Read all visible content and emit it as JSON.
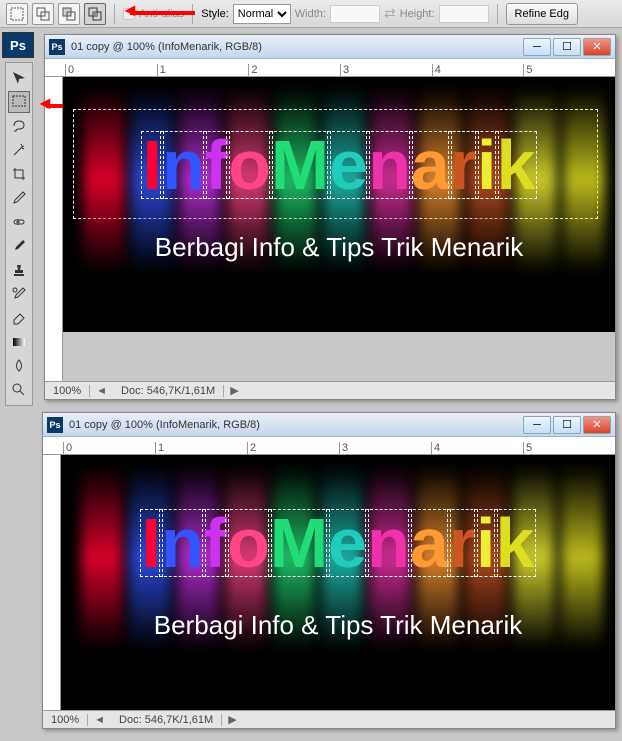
{
  "optionsBar": {
    "antialias": "Anti-alias",
    "styleLabel": "Style:",
    "styleValue": "Normal",
    "widthLabel": "Width:",
    "heightLabel": "Height:",
    "refineEdge": "Refine Edg"
  },
  "document": {
    "title": "01 copy @ 100% (InfoMenarik, RGB/8)",
    "zoom": "100%",
    "docInfo": "Doc: 546,7K/1,61M",
    "rulerMarks": [
      "0",
      "1",
      "2",
      "3",
      "4",
      "5"
    ]
  },
  "artwork": {
    "letters": [
      {
        "c": "I",
        "color": "#ff0033"
      },
      {
        "c": "n",
        "color": "#3355ff"
      },
      {
        "c": "f",
        "color": "#cc33ee"
      },
      {
        "c": "o",
        "color": "#ff4488"
      },
      {
        "c": "M",
        "color": "#22dd77"
      },
      {
        "c": "e",
        "color": "#22ccbb"
      },
      {
        "c": "n",
        "color": "#ee33aa"
      },
      {
        "c": "a",
        "color": "#ff9933"
      },
      {
        "c": "r",
        "color": "#cc5522"
      },
      {
        "c": "i",
        "color": "#eeee33"
      },
      {
        "c": "k",
        "color": "#dddd22"
      }
    ],
    "subtitle": "Berbagi Info & Tips Trik Menarik"
  },
  "tools": [
    "move-tool",
    "marquee-tool",
    "lasso-tool",
    "wand-tool",
    "crop-tool",
    "eyedropper-tool",
    "healing-tool",
    "brush-tool",
    "stamp-tool",
    "history-brush-tool",
    "eraser-tool",
    "gradient-tool",
    "blur-tool",
    "dodge-tool"
  ],
  "optIcons": [
    "new-selection-icon",
    "add-selection-icon",
    "subtract-selection-icon",
    "intersect-selection-icon"
  ],
  "app": {
    "name": "Ps"
  }
}
